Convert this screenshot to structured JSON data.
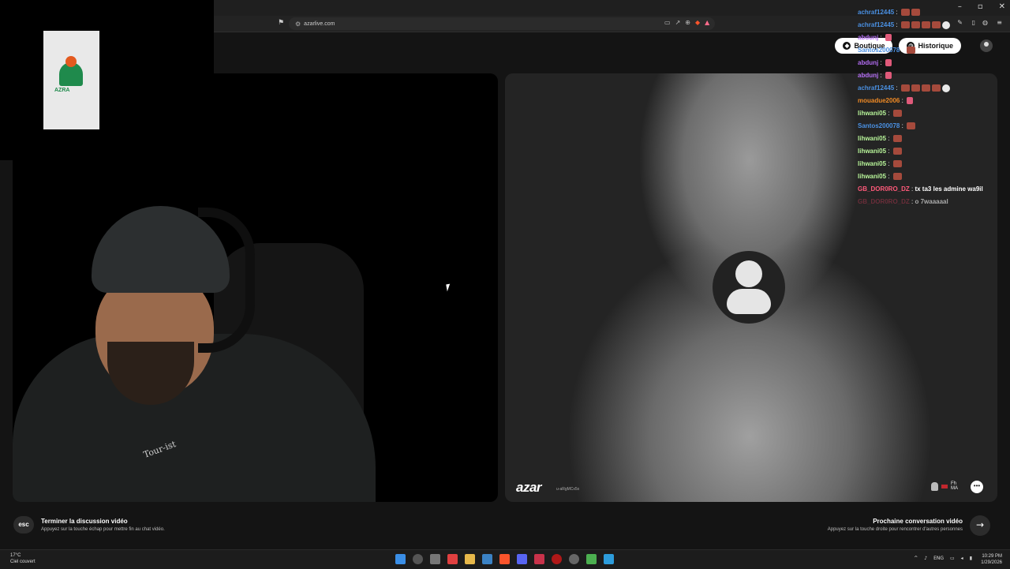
{
  "browser": {
    "url": "azarlive.com",
    "window_controls": [
      "–",
      "▫",
      "✕"
    ]
  },
  "header": {
    "pill_left_label": "Boutique",
    "pill_history_label": "Historique"
  },
  "local_video": {
    "hoodie_text": "Tour-ist"
  },
  "overlay": {
    "logo_text": "AZRA"
  },
  "remote_video": {
    "brand": "azar",
    "user_id": "u-aRgMCx5x",
    "country_flags": "Fh\nMA"
  },
  "bottom": {
    "esc_key": "esc",
    "end_title": "Terminer la discussion vidéo",
    "end_sub": "Appuyez sur la touche échap pour mettre fin au chat vidéo.",
    "next_title": "Prochaine conversation vidéo",
    "next_sub": "Appuyez sur la touche droite pour rencontrer d'autres personnes",
    "next_arrow": "→"
  },
  "chat": [
    {
      "user": "achraf12445",
      "color": "#4a90e2",
      "msg": "",
      "emotes": 2
    },
    {
      "user": "achraf12445",
      "color": "#4a90e2",
      "msg": "",
      "emotes": 5
    },
    {
      "user": "abdunj",
      "color": "#b26cf2",
      "msg": "",
      "emotes": 1
    },
    {
      "user": "Santos200078",
      "color": "#4a90e2",
      "msg": "",
      "emotes": 1
    },
    {
      "user": "abdunj",
      "color": "#b26cf2",
      "msg": "",
      "emotes": 1
    },
    {
      "user": "abdunj",
      "color": "#b26cf2",
      "msg": "",
      "emotes": 1
    },
    {
      "user": "achraf12445",
      "color": "#4a90e2",
      "msg": "",
      "emotes": 5
    },
    {
      "user": "mouadue2006",
      "color": "#f08a24",
      "msg": "",
      "emotes": 1
    },
    {
      "user": "lihwani05",
      "color": "#b8f59a",
      "msg": "",
      "emotes": 1
    },
    {
      "user": "Santos200078",
      "color": "#4a90e2",
      "msg": "",
      "emotes": 1
    },
    {
      "user": "lihwani05",
      "color": "#b8f59a",
      "msg": "",
      "emotes": 1
    },
    {
      "user": "lihwani05",
      "color": "#b8f59a",
      "msg": "",
      "emotes": 1
    },
    {
      "user": "lihwani05",
      "color": "#b8f59a",
      "msg": "",
      "emotes": 1
    },
    {
      "user": "lihwani05",
      "color": "#b8f59a",
      "msg": "",
      "emotes": 1
    },
    {
      "user": "GB_DOR0RO_DZ",
      "color": "#ff5a7a",
      "msg": "tx ta3 les admine wa9il",
      "emotes": 0
    },
    {
      "user": "GB_DOR0RO_DZ",
      "color": "#6b2e3a",
      "msg": "o 7waaaaal",
      "emotes": 0
    }
  ],
  "taskbar": {
    "temperature": "17°C",
    "weather": "Ciel couvert",
    "lang": "ENG",
    "time": "10:29 PM",
    "date": "1/29/2026"
  },
  "colors": {
    "brave": "#fb542b",
    "accent_white": "#ffffff"
  }
}
